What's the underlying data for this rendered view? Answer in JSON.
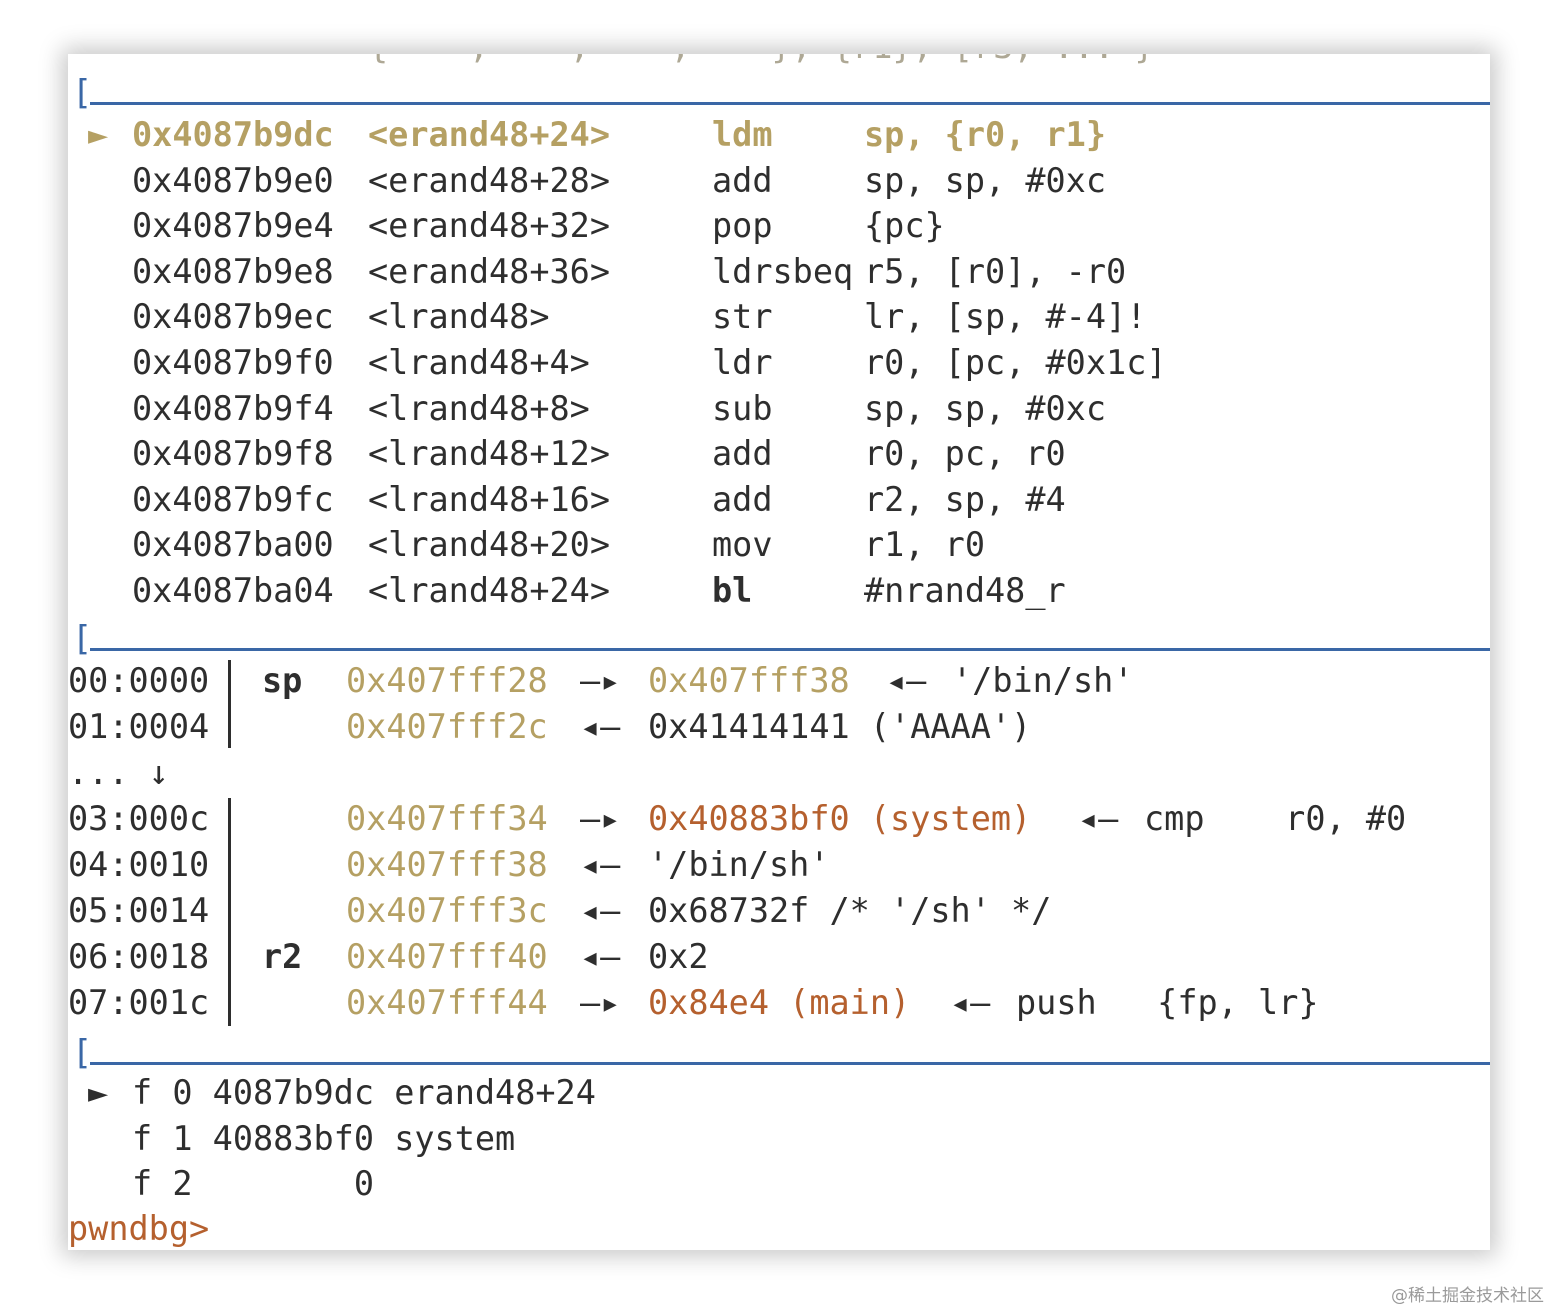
{
  "clipped_top_line": "{    ,    ,    ,    }, {r1}, [r3, ... }",
  "disasm": {
    "current_marker": "►",
    "rows": [
      {
        "addr": "0x4087b9dc",
        "sym": "<erand48+24>",
        "op": "ldm",
        "args": "sp, {r0, r1}",
        "current": true
      },
      {
        "addr": "0x4087b9e0",
        "sym": "<erand48+28>",
        "op": "add",
        "args": "sp, sp, #0xc"
      },
      {
        "addr": "0x4087b9e4",
        "sym": "<erand48+32>",
        "op": "pop",
        "args": "{pc}"
      },
      {
        "addr": "0x4087b9e8",
        "sym": "<erand48+36>",
        "op": "ldrsbeq",
        "args": "r5, [r0], -r0"
      },
      {
        "addr": "0x4087b9ec",
        "sym": "<lrand48>",
        "op": "str",
        "args": "lr, [sp, #-4]!"
      },
      {
        "addr": "0x4087b9f0",
        "sym": "<lrand48+4>",
        "op": "ldr",
        "args": "r0, [pc, #0x1c]"
      },
      {
        "addr": "0x4087b9f4",
        "sym": "<lrand48+8>",
        "op": "sub",
        "args": "sp, sp, #0xc"
      },
      {
        "addr": "0x4087b9f8",
        "sym": "<lrand48+12>",
        "op": "add",
        "args": "r0, pc, r0"
      },
      {
        "addr": "0x4087b9fc",
        "sym": "<lrand48+16>",
        "op": "add",
        "args": "r2, sp, #4"
      },
      {
        "addr": "0x4087ba00",
        "sym": "<lrand48+20>",
        "op": "mov",
        "args": "r1, r0"
      },
      {
        "addr": "0x4087ba04",
        "sym": "<lrand48+24>",
        "op": "bl",
        "args": "#nrand48_r",
        "bold_op": true
      }
    ]
  },
  "stack": {
    "rows": [
      {
        "idx": "00:0000",
        "reg": "sp",
        "addr": "0x407fff28",
        "arrow": "—▸",
        "target": "0x407fff38",
        "target_color": "yellow",
        "tail_arrow": "◂—",
        "tail": "'/bin/sh'"
      },
      {
        "idx": "01:0004",
        "reg": "",
        "addr": "0x407fff2c",
        "arrow": "◂—",
        "target": "0x41414141 ('AAAA')",
        "target_color": "dark",
        "tail_arrow": "",
        "tail": ""
      },
      {
        "idx": "03:000c",
        "reg": "",
        "addr": "0x407fff34",
        "arrow": "—▸",
        "target": "0x40883bf0 (system)",
        "target_color": "orange",
        "tail_arrow": "◂—",
        "tail": "cmp    r0, #0"
      },
      {
        "idx": "04:0010",
        "reg": "",
        "addr": "0x407fff38",
        "arrow": "◂—",
        "target": "'/bin/sh'",
        "target_color": "dark",
        "tail_arrow": "",
        "tail": ""
      },
      {
        "idx": "05:0014",
        "reg": "",
        "addr": "0x407fff3c",
        "arrow": "◂—",
        "target": "0x68732f /* '/sh' */",
        "target_color": "dark",
        "tail_arrow": "",
        "tail": ""
      },
      {
        "idx": "06:0018",
        "reg": "r2",
        "addr": "0x407fff40",
        "arrow": "◂—",
        "target": "0x2",
        "target_color": "dark",
        "tail_arrow": "",
        "tail": ""
      },
      {
        "idx": "07:001c",
        "reg": "",
        "addr": "0x407fff44",
        "arrow": "—▸",
        "target": "0x84e4 (main)",
        "target_color": "orange",
        "tail_arrow": "◂—",
        "tail": "push   {fp, lr}"
      }
    ],
    "ellipsis": "... ↓"
  },
  "backtrace": {
    "rows": [
      {
        "marker": "►",
        "text": "f 0 4087b9dc erand48+24"
      },
      {
        "marker": "",
        "text": "f 1 40883bf0 system"
      },
      {
        "marker": "",
        "text": "f 2        0"
      }
    ]
  },
  "prompt": "pwndbg>",
  "watermark": "@稀土掘金技术社区",
  "colors": {
    "separator": "#3a67a6",
    "address_yellow": "#b5a063",
    "symbol_orange": "#b5602e",
    "text": "#2e2e2e",
    "prompt": "#b5602e"
  }
}
